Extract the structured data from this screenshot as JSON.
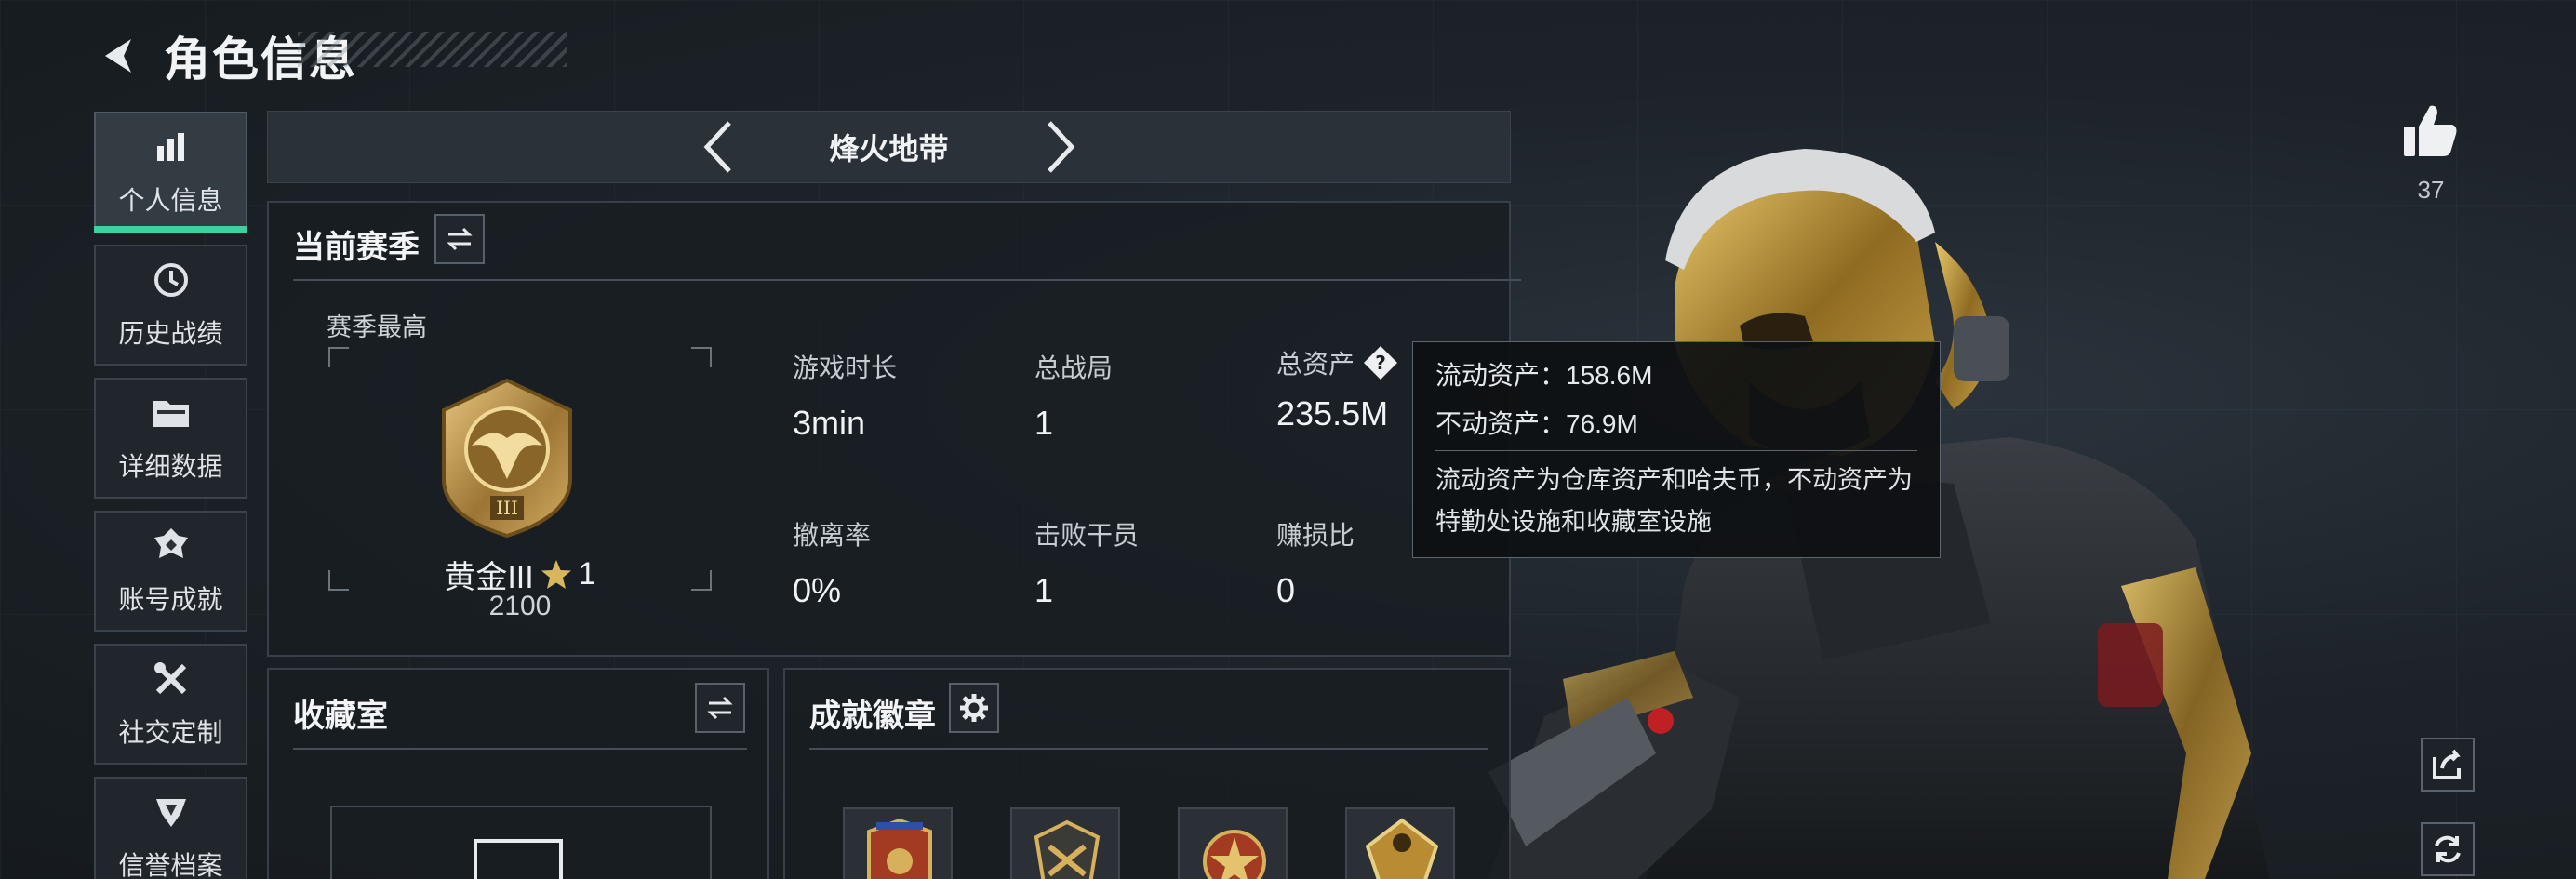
{
  "header": {
    "title": "角色信息",
    "back_icon": "back-arrow-icon"
  },
  "sidebar": {
    "items": [
      {
        "label": "个人信息",
        "icon": "bar-chart-icon",
        "active": true
      },
      {
        "label": "历史战绩",
        "icon": "history-clock-icon"
      },
      {
        "label": "详细数据",
        "icon": "folder-icon"
      },
      {
        "label": "账号成就",
        "icon": "achievement-medal-icon"
      },
      {
        "label": "社交定制",
        "icon": "tools-icon"
      },
      {
        "label": "信誉档案",
        "icon": "shield-badge-icon"
      }
    ]
  },
  "mode_switcher": {
    "name": "烽火地带"
  },
  "current_season": {
    "title": "当前赛季",
    "best_label": "赛季最高",
    "rank": {
      "name": "黄金III",
      "stars": "1",
      "score": "2100"
    },
    "stats": [
      {
        "label": "游戏时长",
        "value": "3min"
      },
      {
        "label": "总战局",
        "value": "1"
      },
      {
        "label": "总资产",
        "value": "235.5M",
        "has_help": true
      },
      {
        "label": "撤离率",
        "value": "0%"
      },
      {
        "label": "击败干员",
        "value": "1"
      },
      {
        "label": "赚损比",
        "value": "0"
      }
    ]
  },
  "asset_tooltip": {
    "liquid": "流动资产：158.6M",
    "fixed": "不动资产：76.9M",
    "desc": "流动资产为仓库资产和哈夫币，不动资产为特勤处设施和收藏室设施"
  },
  "collection": {
    "title": "收藏室"
  },
  "badges": {
    "title": "成就徽章"
  },
  "likes": {
    "count": "37"
  },
  "colors": {
    "accent": "#3fd0a0",
    "panel_border": "#37404a",
    "gold": "#c9a24a"
  }
}
